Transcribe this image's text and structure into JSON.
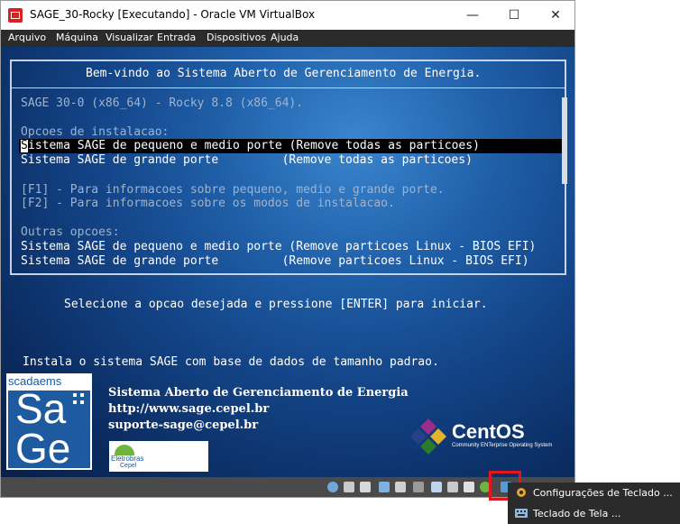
{
  "window": {
    "title": "SAGE_30-Rocky [Executando] - Oracle VM VirtualBox",
    "minimize_glyph": "—",
    "maximize_glyph": "☐",
    "close_glyph": "✕"
  },
  "menu": [
    "Arquivo",
    "Máquina",
    "Visualizar",
    "Entrada",
    "Dispositivos",
    "Ajuda"
  ],
  "boot": {
    "header": "Bem-vindo ao Sistema Aberto de Gerenciamento de Energia.",
    "version": "SAGE 30-0 (x86_64) - Rocky 8.8 (x86_64).",
    "install_heading": "Opcoes de instalacao:",
    "option1_first_char": "S",
    "option1_rest": "istema SAGE de pequeno e medio porte (Remove todas as particoes)",
    "option2": "Sistema SAGE de grande porte         (Remove todas as particoes)",
    "help_f1": "[F1] - Para informacoes sobre pequeno, medio e grande porte.",
    "help_f2": "[F2] - Para informacoes sobre os modos de instalacao.",
    "other_heading": "Outras opcoes:",
    "other1": "Sistema SAGE de pequeno e medio porte (Remove particoes Linux - BIOS EFI)",
    "other2": "Sistema SAGE de grande porte         (Remove particoes Linux - BIOS EFI)",
    "prompt": "Selecione a opcao desejada e pressione [ENTER] para iniciar.",
    "description": "Instala o sistema SAGE com base de dados de tamanho padrao."
  },
  "branding": {
    "line1": "Sistema Aberto de Gerenciamento de Energia",
    "line2": "http://www.sage.cepel.br",
    "line3": "suporte-sage@cepel.br",
    "sage_top": "scadaems",
    "sage_big1": "Sa",
    "sage_big2": "Ge",
    "eletrobras": "Eletrobras",
    "cepel": "Cepel",
    "centos_name": "CentOS",
    "centos_tag": "Community ENTerprise Operating System"
  },
  "context_menu": {
    "item1": "Configurações de Teclado ...",
    "item2": "Teclado de Tela ..."
  },
  "colors": {
    "highlight_red": "#e3161d",
    "menubar": "#2b2b2b",
    "boot_text": "#ffffff",
    "boot_dim_text": "#9fb3cf"
  }
}
